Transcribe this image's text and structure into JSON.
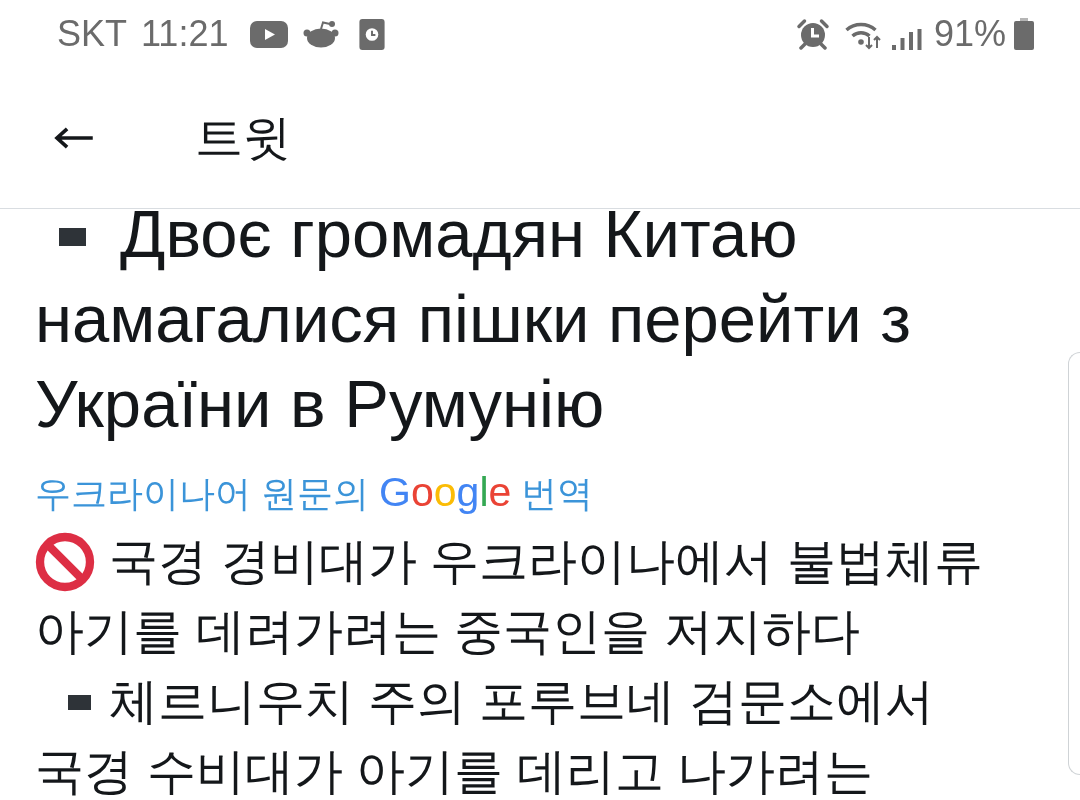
{
  "status_bar": {
    "carrier": "SKT",
    "time": "11:21",
    "battery": "91%"
  },
  "header": {
    "title": "트윗"
  },
  "tweet": {
    "original": {
      "kind": "bullet",
      "lines": [
        "Двоє громадян Китаю",
        "намагалися пішки перейти з",
        "України в Румунію"
      ]
    },
    "translation_link": {
      "before": "우크라이나어 원문의",
      "logo": "Google",
      "after": "번역"
    },
    "translated": [
      {
        "kind": "headline",
        "lines": [
          "국경 경비대가 우크라이나에서 불법체류",
          "아기를 데려가려는 중국인을 저지하다"
        ]
      },
      {
        "kind": "bullet",
        "lines": [
          "체르니우치 주의 포루브네 검문소에서",
          "국경 수비대가 아기를 데리고 나가려는"
        ]
      }
    ]
  }
}
